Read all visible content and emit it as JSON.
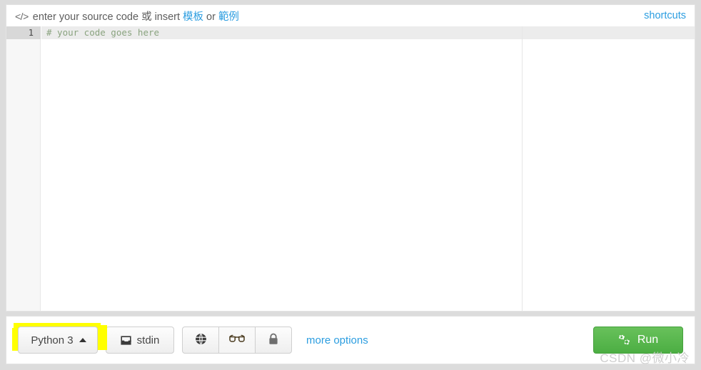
{
  "header": {
    "code_icon": "</>",
    "prefix": "enter your source code",
    "cjk_or": "或",
    "insert": "insert",
    "template_link": "模板",
    "or": "or",
    "example_link": "範例",
    "shortcuts_label": "shortcuts"
  },
  "editor": {
    "line_number": "1",
    "code_text": "# your code goes here",
    "comment_color": "#8aa37f"
  },
  "toolbar": {
    "language_label": "Python 3",
    "language_caret": "caret-up",
    "stdin_label": "stdin",
    "stdin_icon": "inbox-icon",
    "globe_icon": "globe-icon",
    "glasses_icon": "glasses-icon",
    "lock_icon": "lock-icon",
    "more_options_label": "more options",
    "run_label": "Run",
    "run_icon": "gears-icon",
    "run_color": "#4cae43",
    "link_color": "#2b9de0",
    "highlight_color": "#ffff00"
  },
  "watermark": {
    "text": "CSDN @微小冷"
  }
}
